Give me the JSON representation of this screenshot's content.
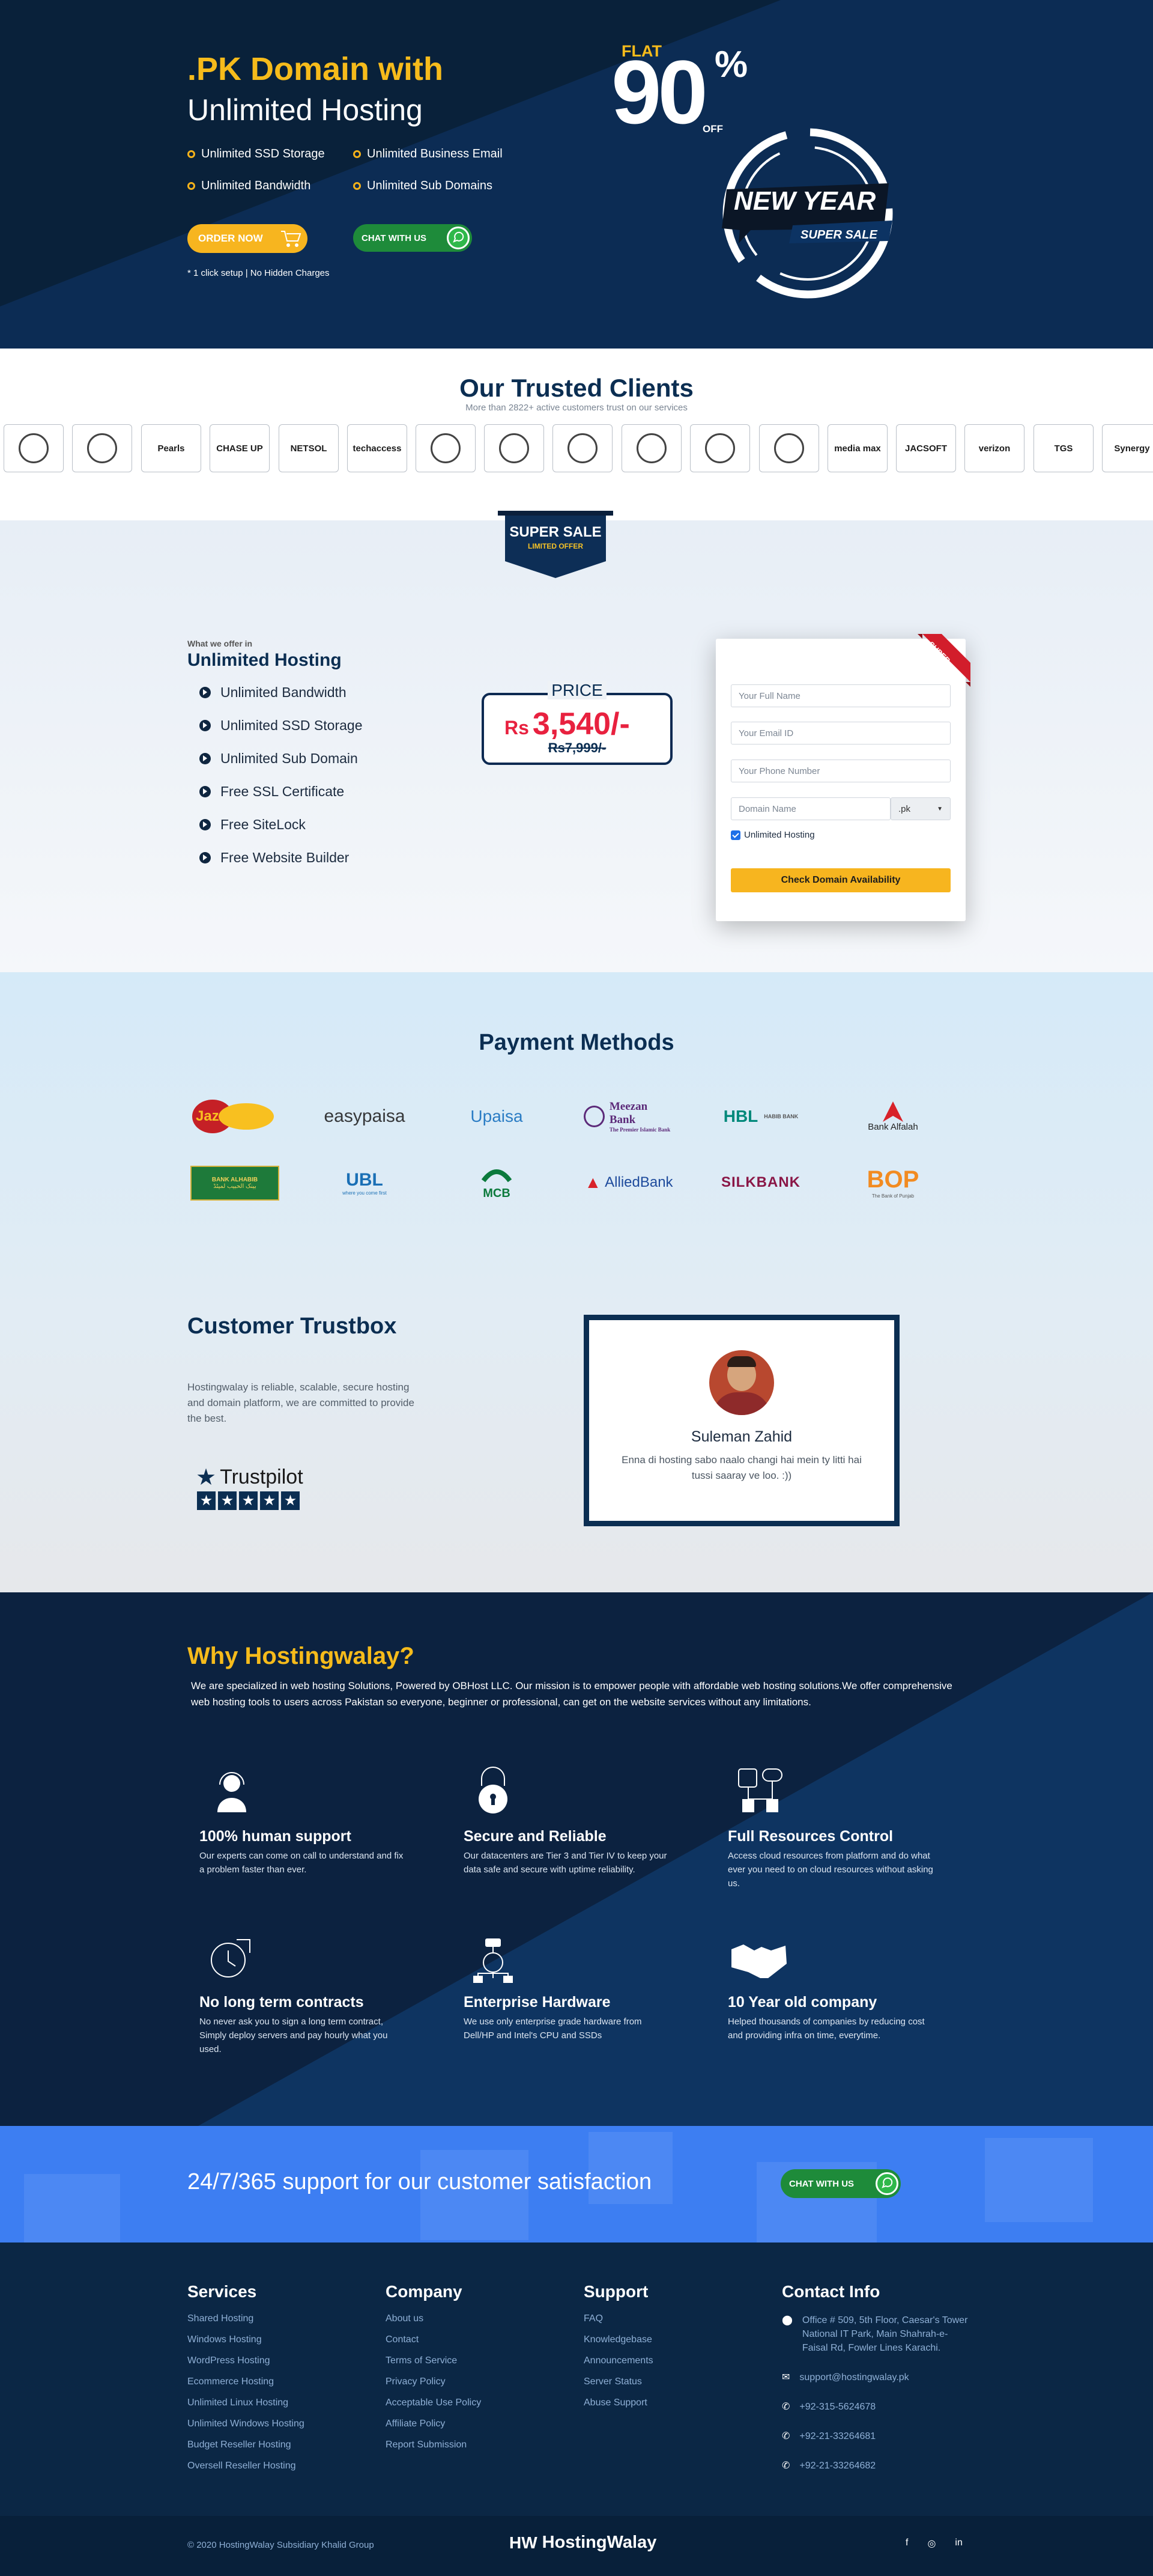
{
  "hero": {
    "title": ".PK Domain with",
    "subtitle": "Unlimited Hosting",
    "features": [
      "Unlimited SSD Storage",
      "Unlimited Business Email",
      "Unlimited Bandwidth",
      "Unlimited Sub Domains"
    ],
    "order_button": "ORDER NOW",
    "chat_button": "CHAT WITH US",
    "note": "* 1 click setup | No Hidden Charges",
    "flat": "FLAT",
    "discount": "90",
    "percent": "%",
    "off": "OFF",
    "new_year": "NEW YEAR",
    "super_sale": "SUPER SALE"
  },
  "clients": {
    "title": "Our Trusted Clients",
    "subtitle": "More than 2822+ active customers trust on our services",
    "logos": [
      "",
      "",
      "Pearls",
      "CHASE UP",
      "NETSOL",
      "techaccess",
      "",
      "",
      "",
      "",
      "",
      "",
      "media max",
      "JACSOFT",
      "verizon",
      "TGS",
      "Synergy"
    ]
  },
  "offer": {
    "ribbon_title": "SUPER SALE",
    "ribbon_sub": "LIMITED OFFER",
    "kicker": "What we offer in",
    "heading": "Unlimited Hosting",
    "items": [
      "Unlimited Bandwidth",
      "Unlimited SSD Storage",
      "Unlimited Sub Domain",
      "Free SSL Certificate",
      "Free SiteLock",
      "Free Website Builder"
    ],
    "price_label": "PRICE",
    "price_currency": "Rs",
    "price": "3,540/-",
    "old_price": "Rs7,999/-"
  },
  "form": {
    "corner": "SUPER SALE",
    "name_placeholder": "Your Full Name",
    "email_placeholder": "Your Email ID",
    "phone_placeholder": "Your Phone Number",
    "domain_placeholder": "Domain Name",
    "tld": ".pk",
    "checkbox_label": "Unlimited Hosting",
    "submit": "Check Domain Availability"
  },
  "payment": {
    "title": "Payment Methods",
    "methods": [
      "JazzCash",
      "easypaisa",
      "Upaisa",
      "Meezan Bank",
      "HBL",
      "Bank Alfalah",
      "BANK ALHABIB",
      "UBL",
      "MCB",
      "AlliedBank",
      "SILKBANK",
      "BOP"
    ],
    "meezan_sub": "The Premier Islamic Bank",
    "hbl_sub": "HABIB BANK",
    "bop_sub": "The Bank of Punjab",
    "ubl_sub": "where you come first",
    "alhabib_sub": "بینک الحبیب لمیٹڈ"
  },
  "trust": {
    "title": "Customer Trustbox",
    "text": "Hostingwalay is reliable, scalable, secure hosting and domain platform, we are committed to provide the best.",
    "trustpilot": "Trustpilot",
    "reviewer": "Suleman Zahid",
    "review": "Enna di hosting sabo naalo changi hai mein ty litti hai tussi saaray ve loo. :))"
  },
  "why": {
    "title": "Why Hostingwalay?",
    "intro": "We are specialized in web hosting Solutions, Powered by OBHost LLC. Our mission is to empower people with affordable web hosting solutions.We offer comprehensive web hosting tools to users across Pakistan so everyone, beginner or professional, can get on the website services without any limitations.",
    "items": [
      {
        "title": "100% human support",
        "text": "Our experts can come on call to understand and fix a problem faster than ever."
      },
      {
        "title": "Secure and Reliable",
        "text": "Our datacenters are Tier 3 and Tier IV to keep your data safe and secure with uptime reliability."
      },
      {
        "title": "Full Resources Control",
        "text": "Access cloud resources from platform and do what ever you need to on cloud resources without asking us."
      },
      {
        "title": "No long term contracts",
        "text": "No never ask you to sign a long term contract, Simply deploy servers and pay hourly what you used."
      },
      {
        "title": "Enterprise Hardware",
        "text": "We use only enterprise grade hardware from Dell/HP and Intel's CPU and SSDs"
      },
      {
        "title": "10 Year old company",
        "text": "Helped thousands of companies by reducing cost and providing infra on time, everytime."
      }
    ]
  },
  "band": {
    "text": "24/7/365 support for our customer satisfaction",
    "chat_button": "CHAT WITH US"
  },
  "footer": {
    "services_title": "Services",
    "services": [
      "Shared Hosting",
      "Windows Hosting",
      "WordPress Hosting",
      "Ecommerce Hosting",
      "Unlimited Linux Hosting",
      "Unlimited Windows Hosting",
      "Budget Reseller Hosting",
      "Oversell Reseller Hosting"
    ],
    "company_title": "Company",
    "company": [
      "About us",
      "Contact",
      "Terms of Service",
      "Privacy Policy",
      "Acceptable Use Policy",
      "Affiliate Policy",
      "Report Submission"
    ],
    "support_title": "Support",
    "support": [
      "FAQ",
      "Knowledgebase",
      "Announcements",
      "Server Status",
      "Abuse Support"
    ],
    "contact_title": "Contact Info",
    "address": "Office # 509, 5th Floor, Caesar's Tower National IT Park, Main Shahrah-e-Faisal Rd, Fowler Lines Karachi.",
    "email": "support@hostingwalay.pk",
    "phones": [
      "+92-315-5624678",
      "+92-21-33264681",
      "+92-21-33264682"
    ],
    "copyright": "© 2020 HostingWalay Subsidiary Khalid Group",
    "brand": "HostingWalay"
  },
  "colors": {
    "navy": "#0b2e52",
    "gold": "#f7b51f",
    "whatsapp": "#1e8b3a",
    "band": "#3d7ef2"
  }
}
